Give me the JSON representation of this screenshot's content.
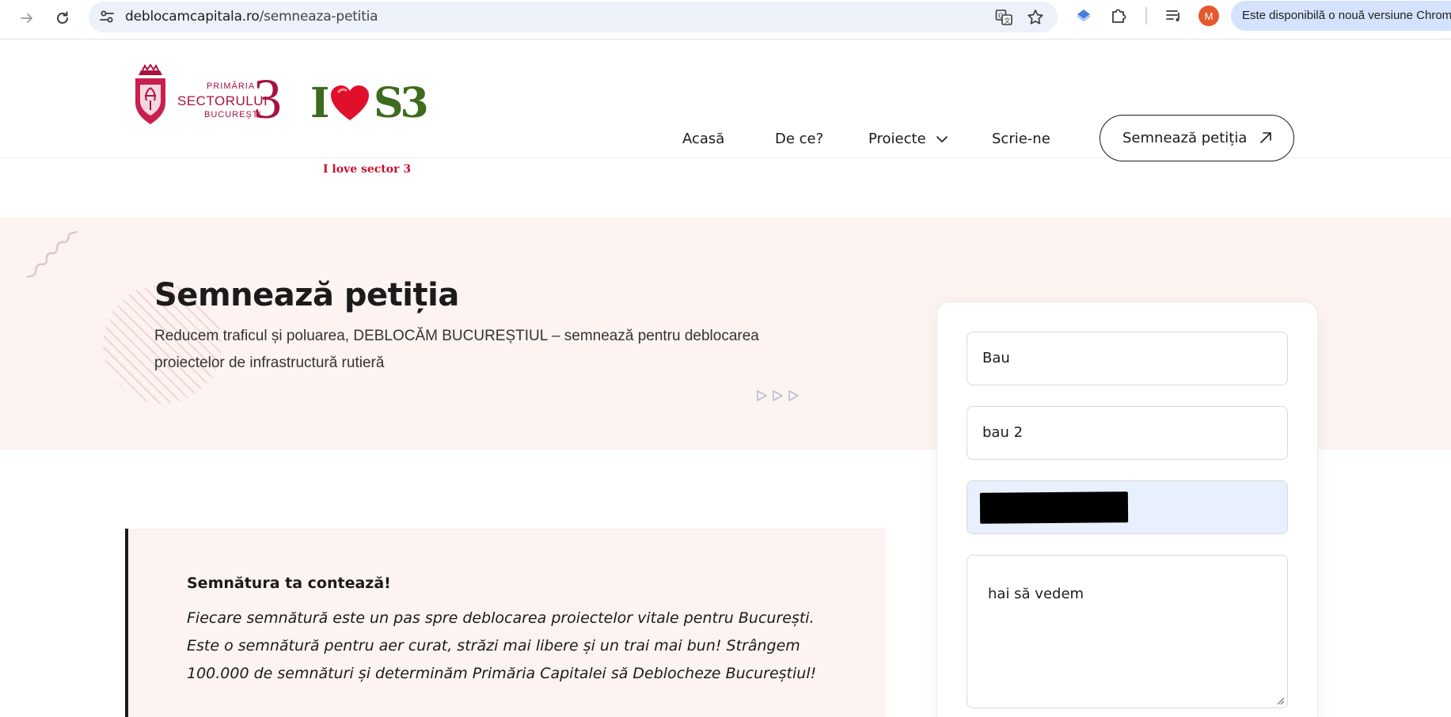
{
  "browser": {
    "url_domain": "deblocamcapitala.ro",
    "url_path": "/semneaza-petitia",
    "profile_initial": "M",
    "update_notice": "Este disponibilă o nouă versiune Chrom"
  },
  "site": {
    "logo_primaria": {
      "line1": "PRIMĂRIA",
      "line2": "SECTORULUI",
      "line3": "BUCUREȘTI",
      "number": "3"
    },
    "logo_ils3": {
      "letter": "I",
      "suffix": "S3",
      "tagline": "I love sector 3"
    },
    "nav": {
      "home": "Acasă",
      "why": "De ce?",
      "projects": "Proiecte",
      "contact": "Scrie-ne"
    },
    "cta_label": "Semnează petiția"
  },
  "hero": {
    "title": "Semnează petiția",
    "subtitle": "Reducem traficul și poluarea, DEBLOCĂM BUCUREȘTIUL – semnează pentru deblocarea proiectelor de infrastructură rutieră"
  },
  "form": {
    "first_name_value": "Bau",
    "last_name_value": "bau 2",
    "message_value": "hai să vedem"
  },
  "quote": {
    "title": "Semnătura ta contează!",
    "body": "Fiecare semnătură este un pas spre deblocarea proiectelor vitale pentru București. Este o semnătură pentru aer curat, străzi mai libere și un trai mai bun! Strângem 100.000 de semnături și determinăm Primăria Capitalei să Deblocheze Bucureștiul!"
  },
  "colors": {
    "brand_red": "#a8123e",
    "hero_bg": "#fdf3f1",
    "autofill_bg": "#e8f0fe",
    "profile_orange": "#e4582b",
    "update_pill": "#d3e3fd"
  }
}
